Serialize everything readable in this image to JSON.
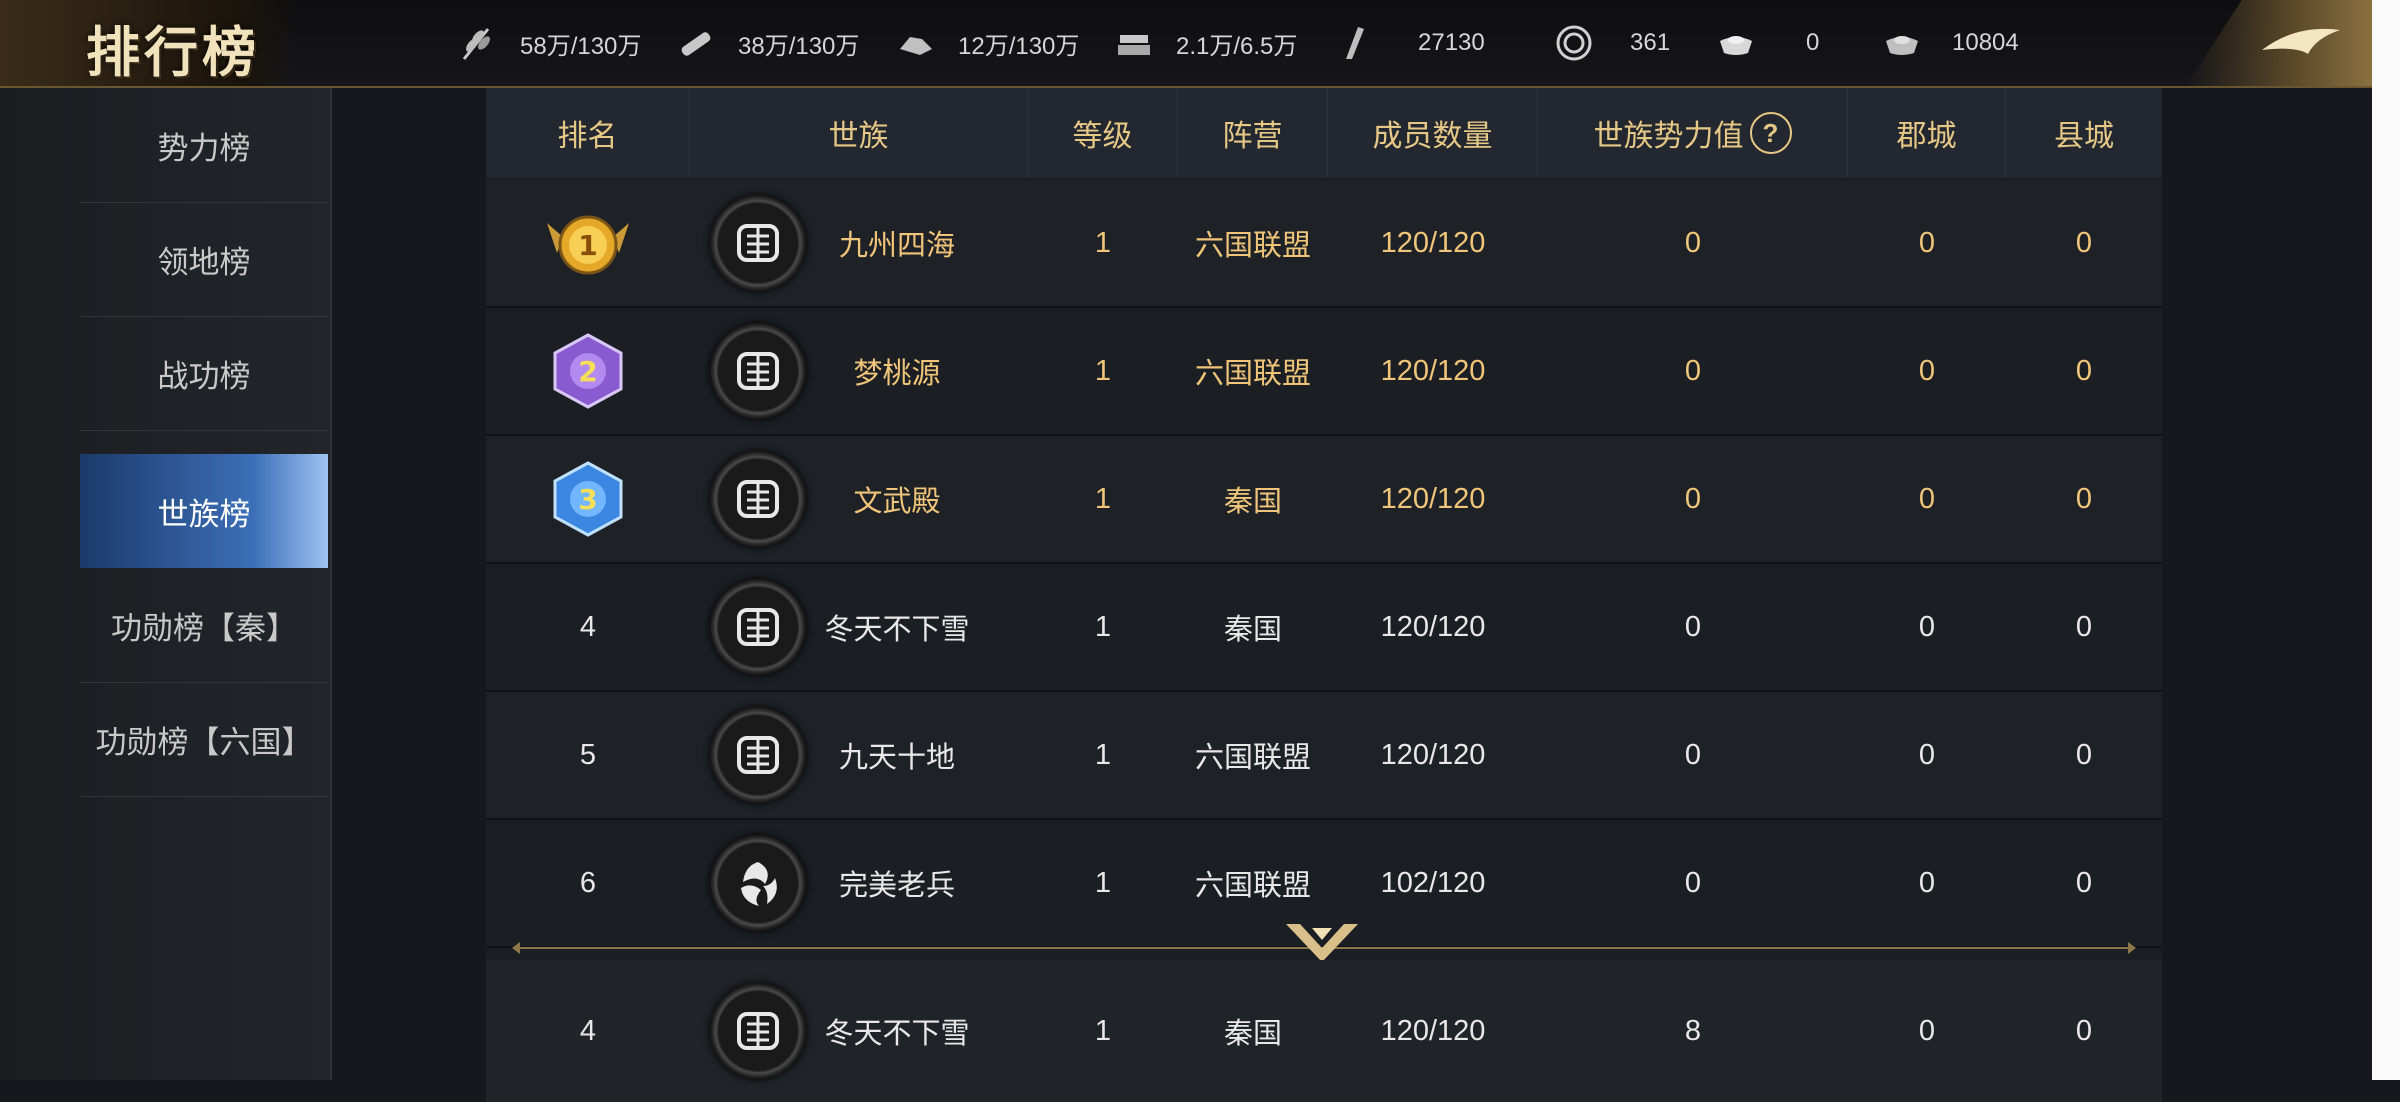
{
  "header": {
    "title": "排行榜"
  },
  "resources": [
    {
      "icon": "grain-icon",
      "value": "58万/130万"
    },
    {
      "icon": "wood-icon",
      "value": "38万/130万"
    },
    {
      "icon": "stone-icon",
      "value": "12万/130万"
    },
    {
      "icon": "iron-icon",
      "value": "2.1万/6.5万"
    },
    {
      "icon": "order-icon",
      "value": "27130"
    },
    {
      "icon": "copper-coin-icon",
      "value": "361"
    },
    {
      "icon": "gold-ingot-icon",
      "value": "0"
    },
    {
      "icon": "silver-ingot-icon",
      "value": "10804"
    }
  ],
  "sidebar": {
    "items": [
      {
        "label": "势力榜"
      },
      {
        "label": "领地榜"
      },
      {
        "label": "战功榜"
      },
      {
        "label": "世族榜"
      },
      {
        "label": "功勋榜【秦】"
      },
      {
        "label": "功勋榜【六国】"
      }
    ],
    "active": "世族榜"
  },
  "table": {
    "columns": [
      "排名",
      "世族",
      "等级",
      "阵营",
      "成员数量",
      "世族势力值",
      "郡城",
      "县城"
    ],
    "help_glyph": "?",
    "rows": [
      {
        "rank": "1",
        "clan": "九州四海",
        "level": "1",
        "faction": "六国联盟",
        "members": "120/120",
        "power": "0",
        "commandery": "0",
        "county": "0"
      },
      {
        "rank": "2",
        "clan": "梦桃源",
        "level": "1",
        "faction": "六国联盟",
        "members": "120/120",
        "power": "0",
        "commandery": "0",
        "county": "0"
      },
      {
        "rank": "3",
        "clan": "文武殿",
        "level": "1",
        "faction": "秦国",
        "members": "120/120",
        "power": "0",
        "commandery": "0",
        "county": "0"
      },
      {
        "rank": "4",
        "clan": "冬天不下雪",
        "level": "1",
        "faction": "秦国",
        "members": "120/120",
        "power": "0",
        "commandery": "0",
        "county": "0"
      },
      {
        "rank": "5",
        "clan": "九天十地",
        "level": "1",
        "faction": "六国联盟",
        "members": "120/120",
        "power": "0",
        "commandery": "0",
        "county": "0"
      },
      {
        "rank": "6",
        "clan": "完美老兵",
        "level": "1",
        "faction": "六国联盟",
        "members": "102/120",
        "power": "0",
        "commandery": "0",
        "county": "0"
      }
    ],
    "my_clan": {
      "rank": "4",
      "clan": "冬天不下雪",
      "level": "1",
      "faction": "秦国",
      "members": "120/120",
      "power": "8",
      "commandery": "0",
      "county": "0"
    }
  },
  "colors": {
    "gold_text": "#e6c886",
    "active_tab": "#3c6fb8",
    "medal_gold": "#f2b830",
    "medal_purple": "#a070e0",
    "medal_blue": "#4aa0ff"
  }
}
